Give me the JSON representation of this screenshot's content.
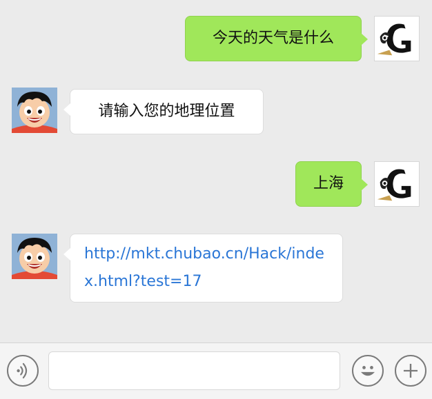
{
  "messages": [
    {
      "side": "right",
      "avatar": "gothic-letter-g-avatar-icon",
      "text": "今天的天气是什么"
    },
    {
      "side": "left",
      "avatar": "cartoon-boy-avatar-icon",
      "text": "请输入您的地理位置"
    },
    {
      "side": "right",
      "avatar": "gothic-letter-g-avatar-icon",
      "text": "上海"
    },
    {
      "side": "left",
      "avatar": "cartoon-boy-avatar-icon",
      "text": "http://mkt.chubao.cn/Hack/index.html?test=17",
      "is_link": true
    }
  ],
  "input_bar": {
    "voice_icon": "voice-icon",
    "message_value": "",
    "emoji_icon": "emoji-icon",
    "plus_icon": "plus-icon"
  },
  "colors": {
    "background": "#ebebeb",
    "bubble_green": "#a0e75a",
    "bubble_white": "#ffffff",
    "link": "#2a76d6"
  }
}
